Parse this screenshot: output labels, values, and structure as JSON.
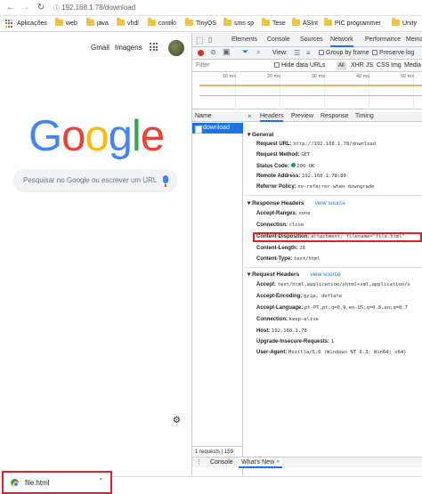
{
  "browser": {
    "url": "192.168.1.78/download",
    "bookmarks": [
      "Aplicações",
      "web",
      "java",
      "vhdl",
      "contiki",
      "TinyOS",
      "sms sp",
      "Tese",
      "ASInt",
      "PIC programmer",
      "Unity"
    ]
  },
  "google": {
    "gmail": "Gmail",
    "images": "Imagens",
    "logo": [
      "G",
      "o",
      "o",
      "g",
      "l",
      "e"
    ],
    "logo_colors": [
      "#4285f4",
      "#ea4335",
      "#fbbc05",
      "#4285f4",
      "#34a853",
      "#ea4335"
    ],
    "search_placeholder": "Pesquisar no Google ou escrever um URL"
  },
  "devtools": {
    "tabs": [
      "Elements",
      "Console",
      "Sources",
      "Network",
      "Performance",
      "Memo"
    ],
    "active_tab": "Network",
    "toolbar": {
      "view": "View:",
      "group_by_frame": "Group by frame",
      "preserve_log": "Preserve log"
    },
    "filter": {
      "placeholder": "Filter",
      "hide_data_urls": "Hide data URLs",
      "types": [
        "XHR",
        "JS",
        "CSS",
        "Img",
        "Media"
      ]
    },
    "timeline_ticks": [
      "10 ms",
      "20 ms",
      "30 ms",
      "40 ms",
      "50 ms"
    ],
    "name_header": "Name",
    "requests": [
      "download"
    ],
    "detail_tabs": [
      "Headers",
      "Preview",
      "Response",
      "Timing"
    ],
    "general_title": "General",
    "general": [
      {
        "k": "Request URL:",
        "v": "http://192.168.1.78/download"
      },
      {
        "k": "Request Method:",
        "v": "GET"
      },
      {
        "k": "Status Code:",
        "v": "200 OK"
      },
      {
        "k": "Remote Address:",
        "v": "192.168.1.78:80"
      },
      {
        "k": "Referrer Policy:",
        "v": "no-referrer-when-downgrade"
      }
    ],
    "response_title": "Response Headers",
    "view_source": "view source",
    "response": [
      {
        "k": "Accept-Ranges:",
        "v": "none"
      },
      {
        "k": "Connection:",
        "v": "close"
      },
      {
        "k": "Content-Disposition:",
        "v": "attachment; filename=\"file.html\""
      },
      {
        "k": "Content-Length:",
        "v": "28"
      },
      {
        "k": "Content-Type:",
        "v": "text/html"
      }
    ],
    "request_title": "Request Headers",
    "request": [
      {
        "k": "Accept:",
        "v": "text/html,application/xhtml+xml,application/x"
      },
      {
        "k": "Accept-Encoding:",
        "v": "gzip, deflate"
      },
      {
        "k": "Accept-Language:",
        "v": "pt-PT,pt;q=0.9,en-US;q=0.8,en;q=0.7"
      },
      {
        "k": "Connection:",
        "v": "keep-alive"
      },
      {
        "k": "Host:",
        "v": "192.168.1.78"
      },
      {
        "k": "Upgrade-Insecure-Requests:",
        "v": "1"
      },
      {
        "k": "User-Agent:",
        "v": "Mozilla/5.0 (Windows NT 6.3; Win64; x64)"
      }
    ],
    "status": "1 requests | 159",
    "drawer_tabs": [
      "Console",
      "What's New"
    ]
  },
  "download": {
    "filename": "file.html"
  }
}
